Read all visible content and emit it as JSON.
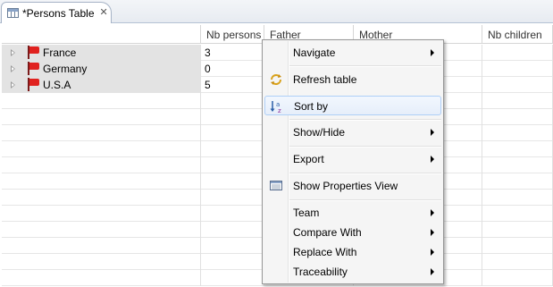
{
  "tab": {
    "title": "*Persons Table",
    "close_glyph": "✕",
    "icon": "table-icon"
  },
  "columns": [
    "",
    "Nb persons",
    "Father",
    "Mother",
    "Nb children"
  ],
  "rows": [
    {
      "label": "France",
      "nb_persons": "3"
    },
    {
      "label": "Germany",
      "nb_persons": "0"
    },
    {
      "label": "U.S.A",
      "nb_persons": "5"
    }
  ],
  "context_menu": {
    "navigate": "Navigate",
    "refresh": "Refresh table",
    "sort_by": "Sort by",
    "show_hide": "Show/Hide",
    "export": "Export",
    "show_properties": "Show Properties View",
    "team": "Team",
    "compare_with": "Compare With",
    "replace_with": "Replace With",
    "traceability": "Traceability"
  },
  "colors": {
    "flag": "#e0221f",
    "selected_row": "#e3e3e3",
    "menu_highlight": "#aecff7"
  }
}
